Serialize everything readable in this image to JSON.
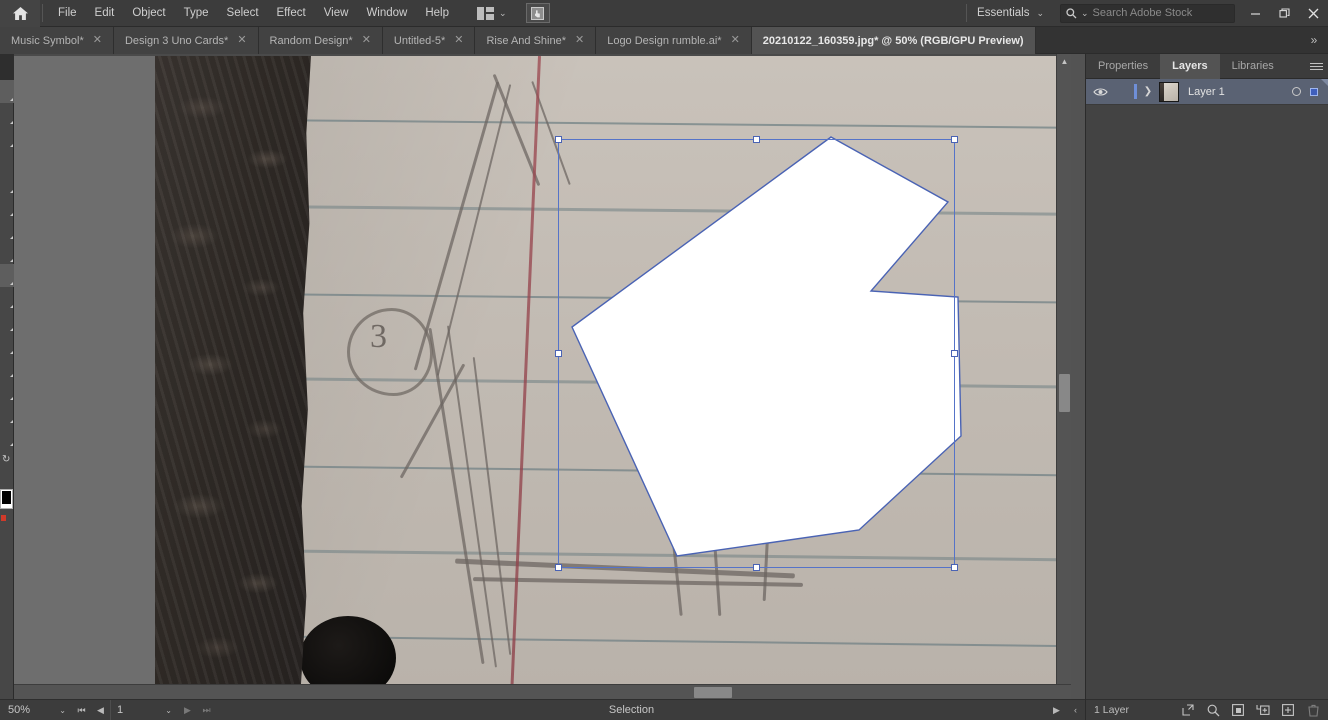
{
  "app": {
    "menus": [
      "File",
      "Edit",
      "Object",
      "Type",
      "Select",
      "Effect",
      "View",
      "Window",
      "Help"
    ],
    "home_icon": "home-icon",
    "arrange_icon": "arrange-documents-icon",
    "arrange_chevron": "⌄",
    "screenmode_icon": "screen-mode-icon",
    "workspace": {
      "label": "Essentials",
      "chevron": "⌄"
    },
    "stock_search": {
      "icon": "search-icon",
      "chevron": "⌄",
      "placeholder": "Search Adobe Stock",
      "value": ""
    },
    "window_controls": {
      "minimize": "—",
      "maximize": "❐",
      "close": "✕"
    }
  },
  "tabs": {
    "close_glyph": "✕",
    "overflow_label": "»",
    "items": [
      {
        "label": "Music Symbol*",
        "active": false
      },
      {
        "label": "Design 3 Uno Cards*",
        "active": false
      },
      {
        "label": "Random Design*",
        "active": false
      },
      {
        "label": "Untitled-5*",
        "active": false
      },
      {
        "label": "Rise And Shine*",
        "active": false
      },
      {
        "label": "Logo Design rumble.ai*",
        "active": false
      },
      {
        "label": "20210122_160359.jpg* @ 50% (RGB/GPU Preview)",
        "active": true
      }
    ]
  },
  "canvas": {
    "document_name": "20210122_160359.jpg",
    "zoom_display": "50%",
    "color_mode": "RGB/GPU Preview",
    "artwork": {
      "fill_color": "#ffffff",
      "stroke_color": "#4a63b4",
      "description": "white polygon shape over photo"
    },
    "selection": {
      "tool": "Selection",
      "bbox_color": "#5573c8",
      "handle_color": "#ffffff",
      "handle_count": 8
    },
    "photo": {
      "subject": "pencil sketch on lined notebook paper",
      "note_mark": "3"
    }
  },
  "statusbar": {
    "zoom": {
      "value": "50%",
      "chevron": "⌄"
    },
    "nav": {
      "first": "⏮",
      "prev": "◀",
      "next": "▶",
      "last": "⏭"
    },
    "artboard": {
      "value": "1",
      "chevron": "⌄"
    },
    "status_text": "Selection",
    "play": "▶",
    "collapse": "‹"
  },
  "panels": {
    "tabs": [
      {
        "label": "Properties",
        "active": false
      },
      {
        "label": "Layers",
        "active": true
      },
      {
        "label": "Libraries",
        "active": false
      }
    ],
    "menu_icon": "panel-menu-icon",
    "layers": {
      "rows": [
        {
          "name": "Layer 1",
          "visible": true,
          "locked": false,
          "selected": true,
          "eye_icon": "eye-icon",
          "expand_icon": "chevron-right-icon",
          "thumbnail": "layer-thumbnail",
          "target_icon": "target-circle-icon",
          "select_indicator_color": "#3f5fbd"
        }
      ],
      "footer": {
        "count_label": "1 Layer",
        "buttons": [
          {
            "name": "locate-object-icon",
            "glyph": "↗"
          },
          {
            "name": "search-layer-icon",
            "glyph": "⌕"
          },
          {
            "name": "make-clipping-mask-icon",
            "glyph": "◰"
          },
          {
            "name": "new-sublayer-icon",
            "glyph": "↳"
          },
          {
            "name": "new-layer-icon",
            "glyph": "+"
          },
          {
            "name": "delete-layer-icon",
            "glyph": "🗑"
          }
        ]
      }
    }
  },
  "toolbar": {
    "tools_visible_count": 22,
    "fill_color": "#ffffff",
    "stroke_color": "#000000"
  }
}
